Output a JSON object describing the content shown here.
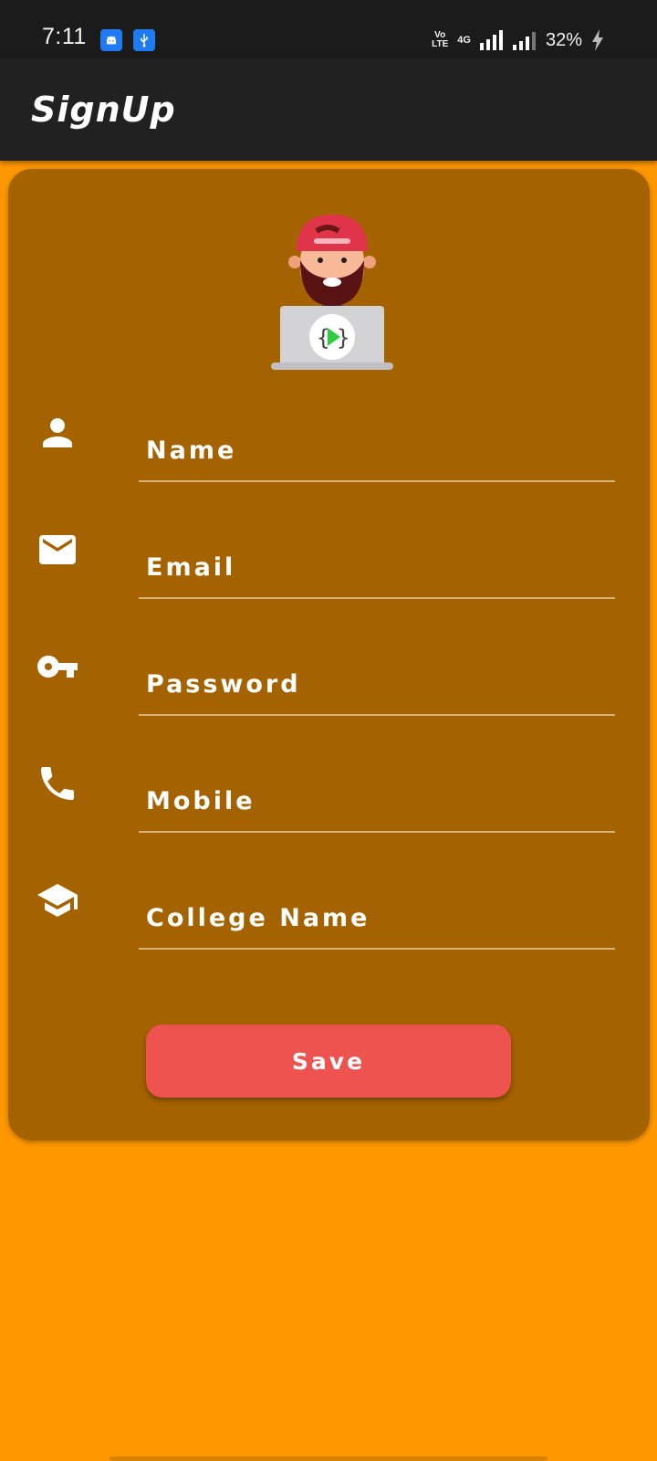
{
  "status_bar": {
    "time": "7:11",
    "volte": "Vo\nLTE",
    "network": "4G",
    "battery": "32%",
    "icons": [
      "android-icon",
      "usb-icon",
      "signal-icon",
      "battery-charging-icon"
    ]
  },
  "app_bar": {
    "title": "SignUp"
  },
  "colors": {
    "background": "#FF9800",
    "card": "#A56300",
    "app_bar": "#212121",
    "status_bar": "#1b1b1b",
    "button": "#EF5350"
  },
  "form": {
    "fields": [
      {
        "icon": "person-icon",
        "placeholder": "Name"
      },
      {
        "icon": "email-icon",
        "placeholder": "Email"
      },
      {
        "icon": "key-icon",
        "placeholder": "Password"
      },
      {
        "icon": "phone-icon",
        "placeholder": "Mobile"
      },
      {
        "icon": "school-icon",
        "placeholder": "College Name"
      }
    ],
    "save_label": "Save"
  }
}
